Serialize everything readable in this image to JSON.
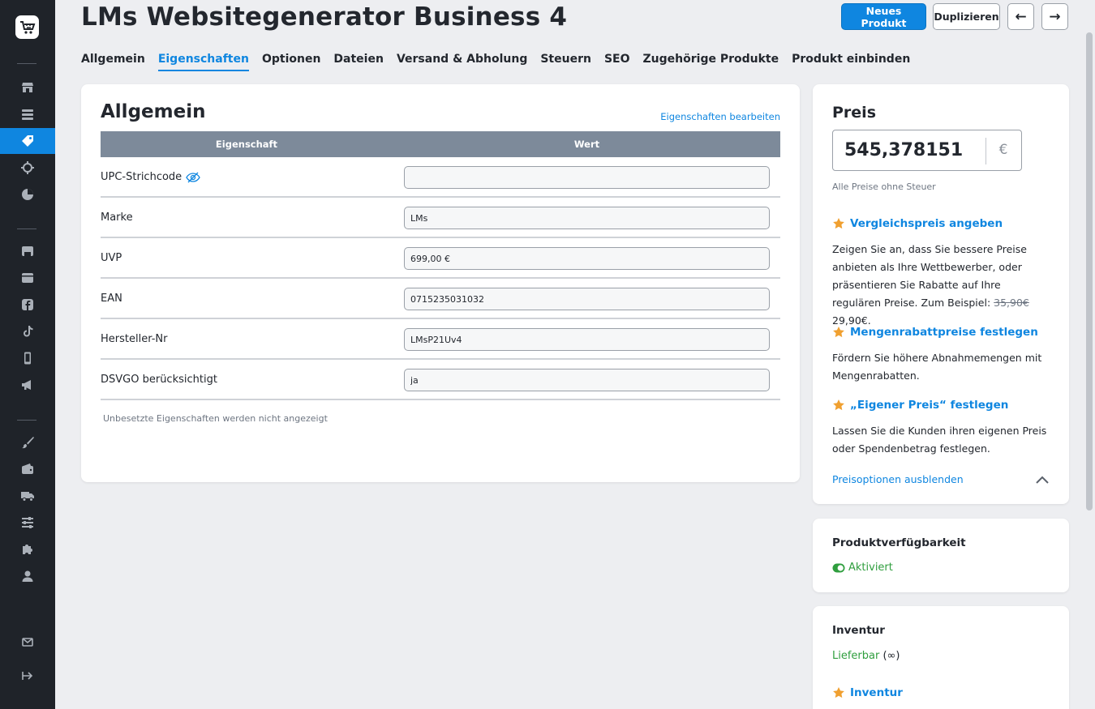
{
  "header": {
    "title": "LMs Websitegenerator Business 4",
    "new_product_label": "Neues Produkt",
    "duplicate_label": "Duplizieren",
    "prev_label": "←",
    "next_label": "→"
  },
  "tabs": [
    {
      "label": "Allgemein"
    },
    {
      "label": "Eigenschaften"
    },
    {
      "label": "Optionen"
    },
    {
      "label": "Dateien"
    },
    {
      "label": "Versand & Abholung"
    },
    {
      "label": "Steuern"
    },
    {
      "label": "SEO"
    },
    {
      "label": "Zugehörige Produkte"
    },
    {
      "label": "Produkt einbinden"
    }
  ],
  "properties": {
    "title": "Allgemein",
    "edit_link": "Eigenschaften bearbeiten",
    "columns": [
      "Eigenschaft",
      "Wert"
    ],
    "rows": [
      {
        "label": "UPC-Strichcode",
        "value": ""
      },
      {
        "label": "Marke",
        "value": "LMs"
      },
      {
        "label": "UVP",
        "value": "699,00 €"
      },
      {
        "label": "EAN",
        "value": "0715235031032"
      },
      {
        "label": "Hersteller-Nr",
        "value": "LMsP21Uv4"
      },
      {
        "label": "DSVGO berücksichtigt",
        "value": "ja"
      }
    ],
    "footnote": "Unbesetzte Eigenschaften werden nicht angezeigt"
  },
  "price": {
    "title": "Preis",
    "value": "545,378151",
    "currency": "€",
    "note": "Alle Preise ohne Steuer",
    "features": [
      {
        "title": "Vergleichspreis angeben",
        "desc_before": "Zeigen Sie an, dass Sie bessere Preise anbieten als Ihre Wettbewerber, oder präsentieren Sie Rabatte auf Ihre regulären Preise. Zum Beispiel: ",
        "old_price": "35,90€",
        "new_price": " 29,90€."
      },
      {
        "title": "Mengenrabattpreise festlegen",
        "desc": "Fördern Sie höhere Abnahmemengen mit Mengenrabatten."
      },
      {
        "title": "„Eigener Preis“ festlegen",
        "desc": "Lassen Sie die Kunden ihren eigenen Preis oder Spendenbetrag festlegen."
      }
    ],
    "hide_link": "Preisoptionen ausblenden"
  },
  "availability": {
    "title": "Produktverfügbarkeit",
    "status": "Aktiviert"
  },
  "inventory": {
    "title": "Inventur",
    "status": "Lieferbar",
    "qty": "(∞)",
    "feature_title": "Inventur"
  },
  "colors": {
    "accent": "#0f86e0",
    "sidebar": "#1f2329",
    "success": "#2f9e3e",
    "star": "#f0a030"
  }
}
